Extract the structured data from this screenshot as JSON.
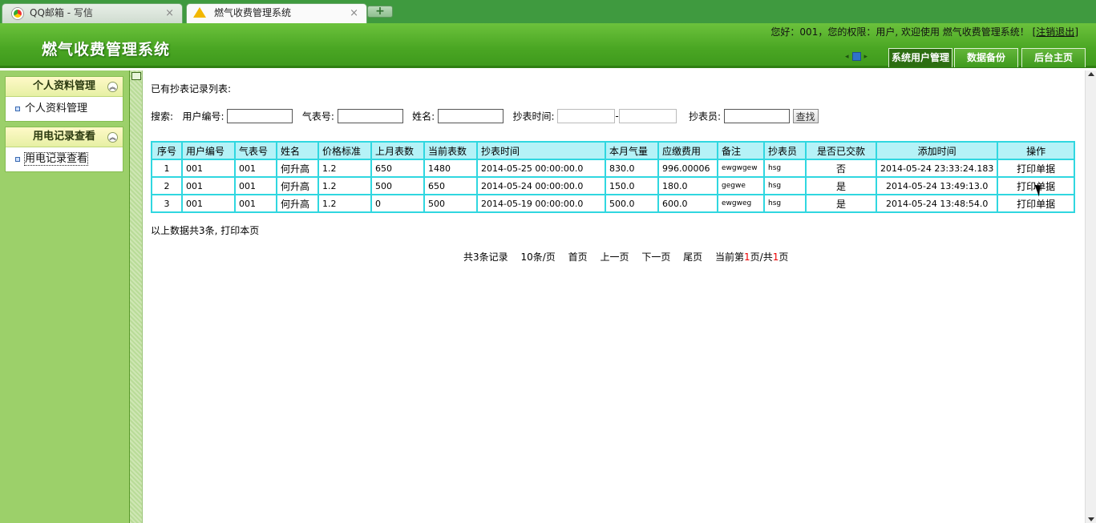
{
  "browser": {
    "tabs": [
      {
        "title": "QQ邮箱 - 写信",
        "close": "×"
      },
      {
        "title": "燃气收费管理系统",
        "close": "×"
      }
    ],
    "new_tab": "+"
  },
  "header": {
    "title": "燃气收费管理系统",
    "greeting": "您好：001，您的权限：用户, 欢迎使用 燃气收费管理系统！",
    "logout_open": "[",
    "logout": "注销退出",
    "logout_close": "]",
    "nav_tabs": [
      "系统用户管理",
      "数据备份",
      "后台主页"
    ],
    "nav_prev": "◂",
    "nav_next": "▸"
  },
  "sidebar": {
    "panels": [
      {
        "title": "个人资料管理",
        "toggle": "︽",
        "items": [
          "个人资料管理"
        ]
      },
      {
        "title": "用电记录查看",
        "toggle": "︽",
        "items": [
          "用电记录查看"
        ]
      }
    ]
  },
  "main": {
    "list_title": "已有抄表记录列表:",
    "search": {
      "label": "搜索:",
      "user_id_label": "用户编号:",
      "meter_label": "气表号:",
      "name_label": "姓名:",
      "time_label": "抄表时间:",
      "dash": "-",
      "reader_label": "抄表员:",
      "button": "查找",
      "user_id_value": "",
      "meter_value": "",
      "name_value": "",
      "time_from": "",
      "time_to": "",
      "reader_value": ""
    },
    "table": {
      "headers": [
        "序号",
        "用户编号",
        "气表号",
        "姓名",
        "价格标准",
        "上月表数",
        "当前表数",
        "抄表时间",
        "本月气量",
        "应缴费用",
        "备注",
        "抄表员",
        "是否已交款",
        "添加时间",
        "操作"
      ],
      "rows": [
        [
          "1",
          "001",
          "001",
          "何升高",
          "1.2",
          "650",
          "1480",
          "2014-05-25 00:00:00.0",
          "830.0",
          "996.00006",
          "ewgwgew",
          "hsg",
          "否",
          "2014-05-24 23:33:24.183",
          "打印单据"
        ],
        [
          "2",
          "001",
          "001",
          "何升高",
          "1.2",
          "500",
          "650",
          "2014-05-24 00:00:00.0",
          "150.0",
          "180.0",
          "gegwe",
          "hsg",
          "是",
          "2014-05-24 13:49:13.0",
          "打印单据"
        ],
        [
          "3",
          "001",
          "001",
          "何升高",
          "1.2",
          "0",
          "500",
          "2014-05-19 00:00:00.0",
          "500.0",
          "600.0",
          "ewgweg",
          "hsg",
          "是",
          "2014-05-24 13:48:54.0",
          "打印单据"
        ]
      ]
    },
    "summary": "以上数据共3条, 打印本页",
    "pager": {
      "total": "共3条记录",
      "per_page": "10条/页",
      "first": "首页",
      "prev": "上一页",
      "next": "下一页",
      "last": "尾页",
      "current_prefix": "当前第",
      "current_page": "1",
      "current_mid": "页/共",
      "total_pages": "1",
      "current_suffix": "页"
    }
  },
  "colors": {
    "header_green": "#4aa623",
    "sidebar_green": "#9cd06a",
    "table_border": "#30d7e0",
    "table_header_bg": "#b5f2f7",
    "pager_highlight": "#e00000"
  }
}
